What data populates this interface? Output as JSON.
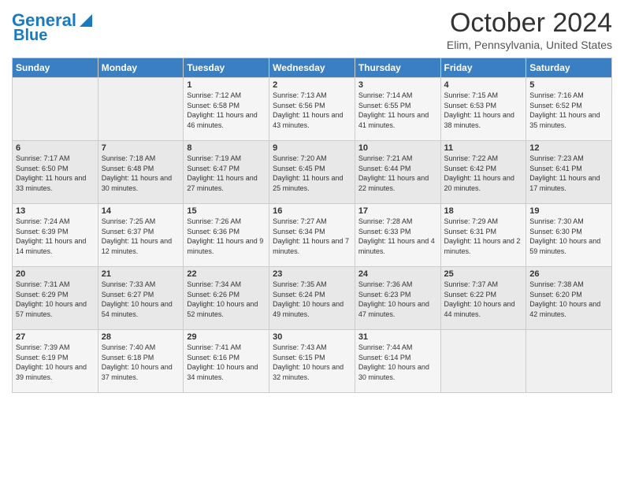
{
  "header": {
    "logo_line1": "General",
    "logo_line2": "Blue",
    "month_title": "October 2024",
    "location": "Elim, Pennsylvania, United States"
  },
  "days_of_week": [
    "Sunday",
    "Monday",
    "Tuesday",
    "Wednesday",
    "Thursday",
    "Friday",
    "Saturday"
  ],
  "weeks": [
    [
      {
        "day": "",
        "info": ""
      },
      {
        "day": "",
        "info": ""
      },
      {
        "day": "1",
        "info": "Sunrise: 7:12 AM\nSunset: 6:58 PM\nDaylight: 11 hours and 46 minutes."
      },
      {
        "day": "2",
        "info": "Sunrise: 7:13 AM\nSunset: 6:56 PM\nDaylight: 11 hours and 43 minutes."
      },
      {
        "day": "3",
        "info": "Sunrise: 7:14 AM\nSunset: 6:55 PM\nDaylight: 11 hours and 41 minutes."
      },
      {
        "day": "4",
        "info": "Sunrise: 7:15 AM\nSunset: 6:53 PM\nDaylight: 11 hours and 38 minutes."
      },
      {
        "day": "5",
        "info": "Sunrise: 7:16 AM\nSunset: 6:52 PM\nDaylight: 11 hours and 35 minutes."
      }
    ],
    [
      {
        "day": "6",
        "info": "Sunrise: 7:17 AM\nSunset: 6:50 PM\nDaylight: 11 hours and 33 minutes."
      },
      {
        "day": "7",
        "info": "Sunrise: 7:18 AM\nSunset: 6:48 PM\nDaylight: 11 hours and 30 minutes."
      },
      {
        "day": "8",
        "info": "Sunrise: 7:19 AM\nSunset: 6:47 PM\nDaylight: 11 hours and 27 minutes."
      },
      {
        "day": "9",
        "info": "Sunrise: 7:20 AM\nSunset: 6:45 PM\nDaylight: 11 hours and 25 minutes."
      },
      {
        "day": "10",
        "info": "Sunrise: 7:21 AM\nSunset: 6:44 PM\nDaylight: 11 hours and 22 minutes."
      },
      {
        "day": "11",
        "info": "Sunrise: 7:22 AM\nSunset: 6:42 PM\nDaylight: 11 hours and 20 minutes."
      },
      {
        "day": "12",
        "info": "Sunrise: 7:23 AM\nSunset: 6:41 PM\nDaylight: 11 hours and 17 minutes."
      }
    ],
    [
      {
        "day": "13",
        "info": "Sunrise: 7:24 AM\nSunset: 6:39 PM\nDaylight: 11 hours and 14 minutes."
      },
      {
        "day": "14",
        "info": "Sunrise: 7:25 AM\nSunset: 6:37 PM\nDaylight: 11 hours and 12 minutes."
      },
      {
        "day": "15",
        "info": "Sunrise: 7:26 AM\nSunset: 6:36 PM\nDaylight: 11 hours and 9 minutes."
      },
      {
        "day": "16",
        "info": "Sunrise: 7:27 AM\nSunset: 6:34 PM\nDaylight: 11 hours and 7 minutes."
      },
      {
        "day": "17",
        "info": "Sunrise: 7:28 AM\nSunset: 6:33 PM\nDaylight: 11 hours and 4 minutes."
      },
      {
        "day": "18",
        "info": "Sunrise: 7:29 AM\nSunset: 6:31 PM\nDaylight: 11 hours and 2 minutes."
      },
      {
        "day": "19",
        "info": "Sunrise: 7:30 AM\nSunset: 6:30 PM\nDaylight: 10 hours and 59 minutes."
      }
    ],
    [
      {
        "day": "20",
        "info": "Sunrise: 7:31 AM\nSunset: 6:29 PM\nDaylight: 10 hours and 57 minutes."
      },
      {
        "day": "21",
        "info": "Sunrise: 7:33 AM\nSunset: 6:27 PM\nDaylight: 10 hours and 54 minutes."
      },
      {
        "day": "22",
        "info": "Sunrise: 7:34 AM\nSunset: 6:26 PM\nDaylight: 10 hours and 52 minutes."
      },
      {
        "day": "23",
        "info": "Sunrise: 7:35 AM\nSunset: 6:24 PM\nDaylight: 10 hours and 49 minutes."
      },
      {
        "day": "24",
        "info": "Sunrise: 7:36 AM\nSunset: 6:23 PM\nDaylight: 10 hours and 47 minutes."
      },
      {
        "day": "25",
        "info": "Sunrise: 7:37 AM\nSunset: 6:22 PM\nDaylight: 10 hours and 44 minutes."
      },
      {
        "day": "26",
        "info": "Sunrise: 7:38 AM\nSunset: 6:20 PM\nDaylight: 10 hours and 42 minutes."
      }
    ],
    [
      {
        "day": "27",
        "info": "Sunrise: 7:39 AM\nSunset: 6:19 PM\nDaylight: 10 hours and 39 minutes."
      },
      {
        "day": "28",
        "info": "Sunrise: 7:40 AM\nSunset: 6:18 PM\nDaylight: 10 hours and 37 minutes."
      },
      {
        "day": "29",
        "info": "Sunrise: 7:41 AM\nSunset: 6:16 PM\nDaylight: 10 hours and 34 minutes."
      },
      {
        "day": "30",
        "info": "Sunrise: 7:43 AM\nSunset: 6:15 PM\nDaylight: 10 hours and 32 minutes."
      },
      {
        "day": "31",
        "info": "Sunrise: 7:44 AM\nSunset: 6:14 PM\nDaylight: 10 hours and 30 minutes."
      },
      {
        "day": "",
        "info": ""
      },
      {
        "day": "",
        "info": ""
      }
    ]
  ]
}
